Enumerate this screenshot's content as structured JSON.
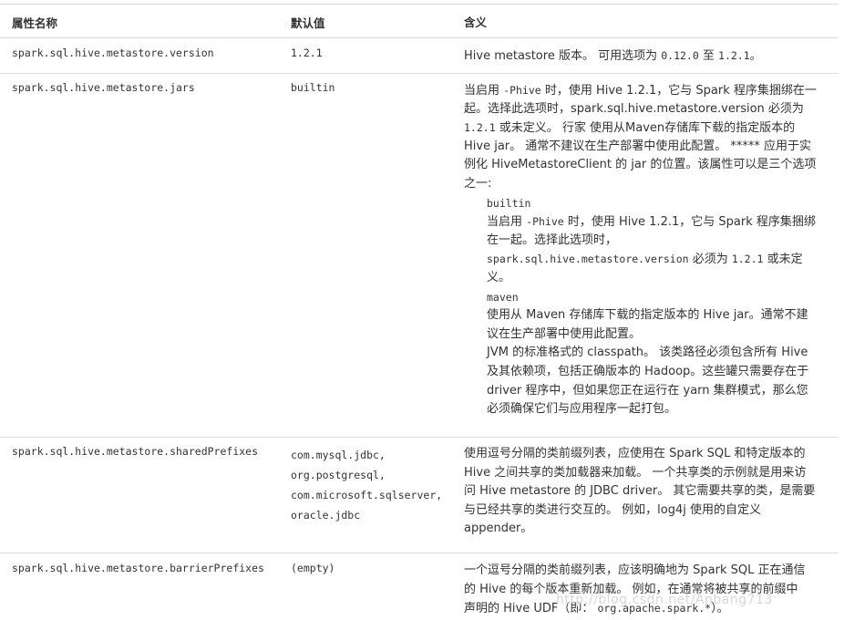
{
  "header": {
    "col1": "属性名称",
    "col2": "默认值",
    "col3": "含义"
  },
  "rows": [
    {
      "name": "spark.sql.hive.metastore.version",
      "default": "1.2.1",
      "desc": {
        "a": "Hive metastore 版本。 可用选项为 ",
        "b": "0.12.0",
        "c": " 至 ",
        "d": "1.2.1",
        "e": "。"
      }
    },
    {
      "name": "spark.sql.hive.metastore.jars",
      "default": "builtin",
      "desc": {
        "l1a": "当启用 ",
        "l1b": "-Phive",
        "l1c": " 时，使用 Hive 1.2.1，它与 Spark 程序集捆绑在一",
        "l2": "起。选择此选项时，spark.sql.hive.metastore.version 必须为",
        "l3a": "1.2.1",
        "l3b": " 或未定义。 行家 使用从Maven存储库下载的指定版本的",
        "l4": "Hive jar。 通常不建议在生产部署中使用此配置。 ***** 应用于实",
        "l5": "例化 HiveMetastoreClient 的 jar 的位置。该属性可以是三个选项",
        "l6": "之一:",
        "sub1_title": "builtin",
        "sub1_l1a": "当启用 ",
        "sub1_l1b": "-Phive",
        "sub1_l1c": " 时，使用 Hive 1.2.1，它与 Spark 程序集捆绑",
        "sub1_l2": "在一起。选择此选项时，",
        "sub1_l3a": "spark.sql.hive.metastore.version",
        "sub1_l3b": " 必须为 ",
        "sub1_l3c": "1.2.1",
        "sub1_l3d": " 或未定",
        "sub1_l4": "义。",
        "sub2_title": "maven",
        "sub2_l1": "使用从 Maven 存储库下载的指定版本的 Hive jar。通常不建",
        "sub2_l2": "议在生产部署中使用此配置。",
        "sub3_l1": "JVM 的标准格式的 classpath。 该类路径必须包含所有 Hive",
        "sub3_l2": "及其依赖项，包括正确版本的 Hadoop。这些罐只需要存在于",
        "sub3_l3": "driver 程序中，但如果您正在运行在 yarn 集群模式，那么您",
        "sub3_l4": "必须确保它们与应用程序一起打包。"
      }
    },
    {
      "name": "spark.sql.hive.metastore.sharedPrefixes",
      "defaults": [
        "com.mysql.jdbc,",
        "org.postgresql,",
        "com.microsoft.sqlserver,",
        "oracle.jdbc"
      ],
      "desc": {
        "l1": "使用逗号分隔的类前缀列表，应使用在 Spark SQL 和特定版本的",
        "l2": "Hive 之间共享的类加载器来加载。 一个共享类的示例就是用来访",
        "l3": "问 Hive metastore 的 JDBC driver。 其它需要共享的类，是需要",
        "l4": "与已经共享的类进行交互的。 例如，log4j 使用的自定义",
        "l5": "appender。"
      }
    },
    {
      "name": "spark.sql.hive.metastore.barrierPrefixes",
      "default": "(empty)",
      "desc": {
        "l1": "一个逗号分隔的类前缀列表，应该明确地为 Spark SQL 正在通信",
        "l2": "的 Hive 的每个版本重新加载。 例如，在通常将被共享的前缀中",
        "l3a": "声明的 Hive UDF（即： ",
        "l3b": "org.apache.spark.*",
        "l3c": "）。"
      }
    }
  ],
  "watermark": "http://blog.csdn.net/Anbang713"
}
